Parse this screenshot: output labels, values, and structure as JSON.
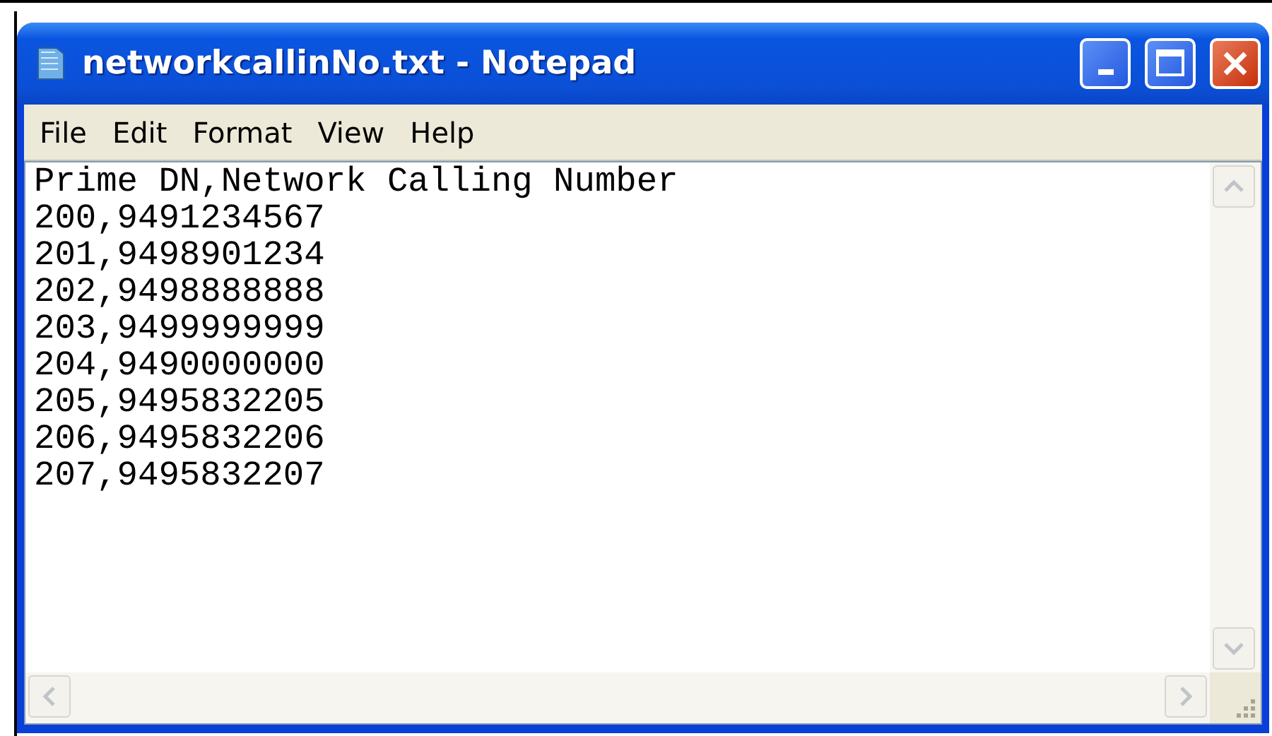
{
  "window": {
    "title": "networkcallinNo.txt - Notepad"
  },
  "menu": [
    "File",
    "Edit",
    "Format",
    "View",
    "Help"
  ],
  "lines": [
    "Prime DN,Network Calling Number",
    "200,9491234567",
    "201,9498901234",
    "202,9498888888",
    "203,9499999999",
    "204,9490000000",
    "205,9495832205",
    "206,9495832206",
    "207,9495832207"
  ]
}
